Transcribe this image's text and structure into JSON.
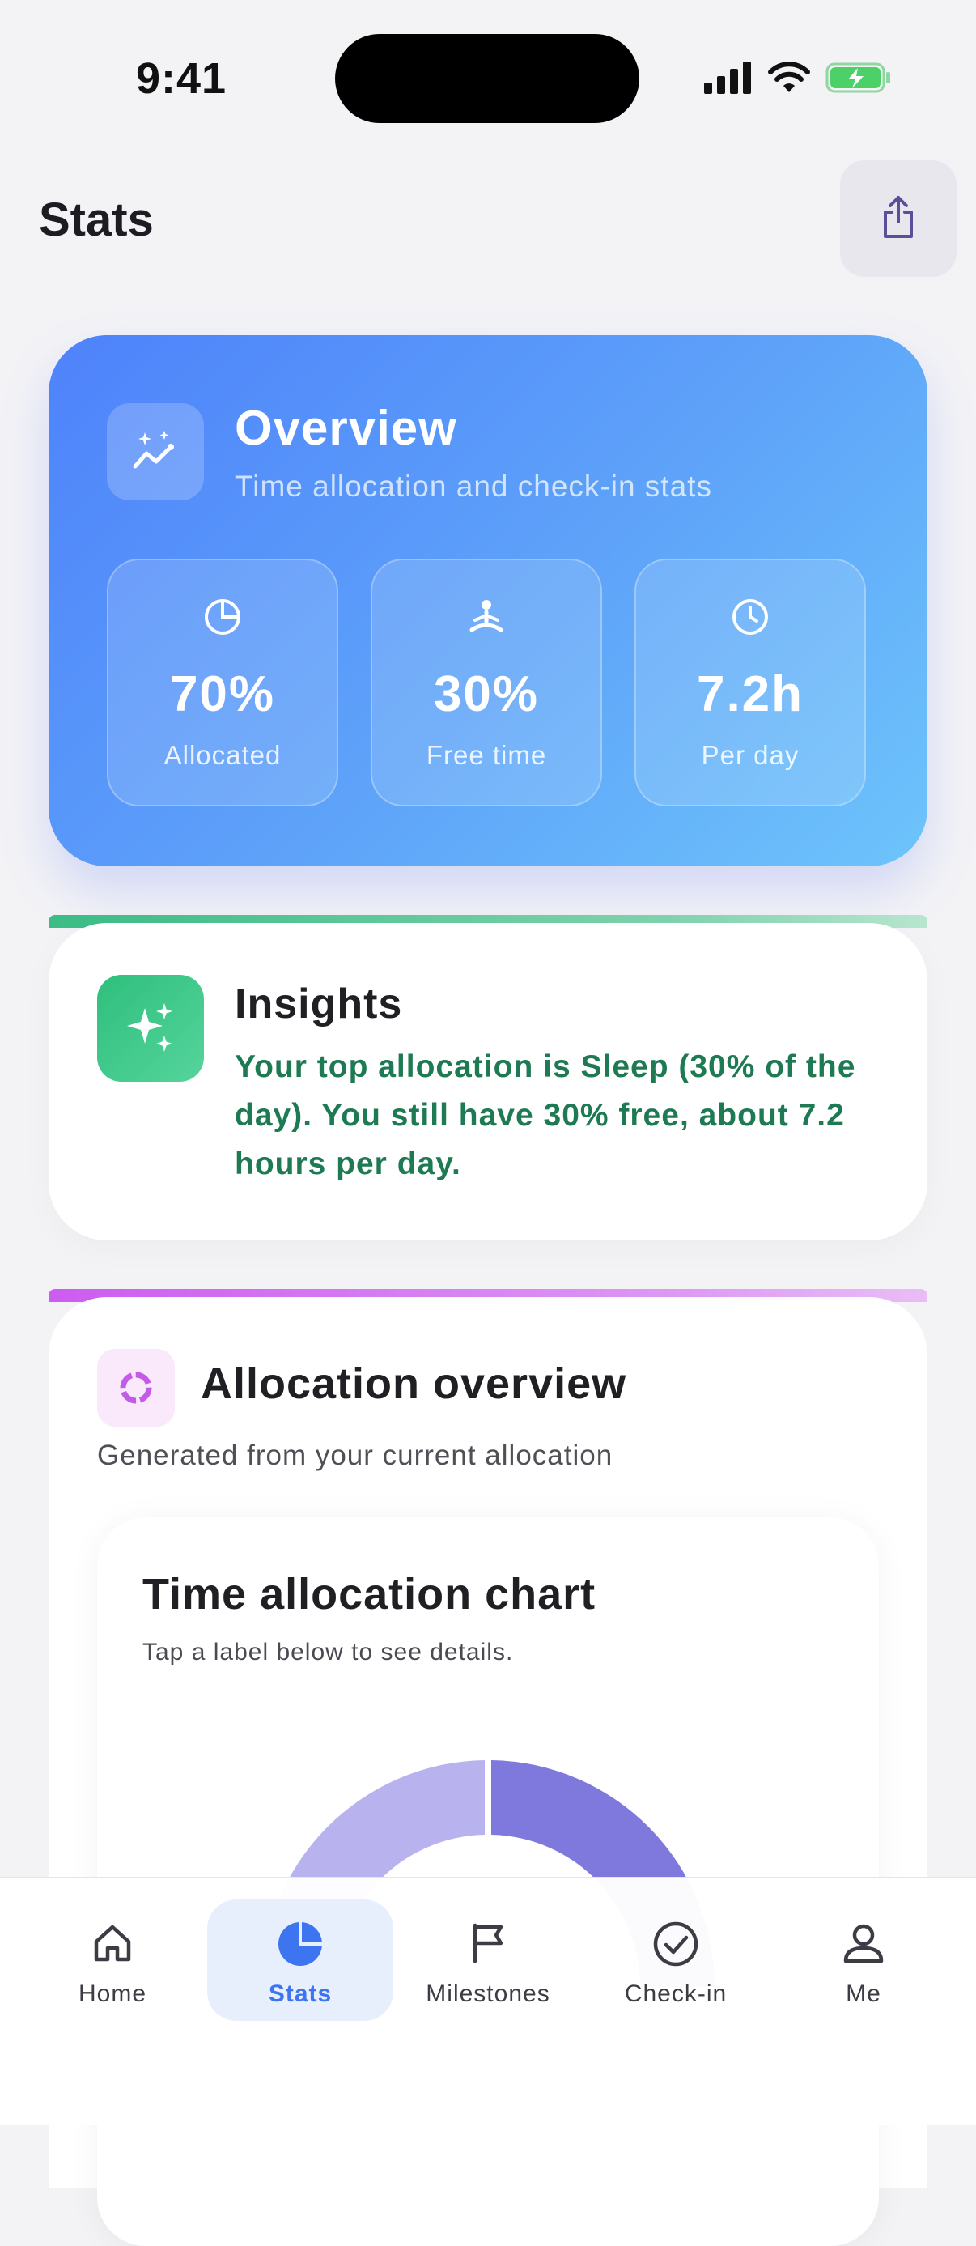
{
  "status_bar": {
    "time": "9:41",
    "icons": [
      "cellular-signal-icon",
      "wifi-icon",
      "battery-charging-icon"
    ]
  },
  "header": {
    "title": "Stats",
    "share_icon": "share-icon"
  },
  "overview": {
    "title": "Overview",
    "subtitle": "Time allocation and check-in stats",
    "icon": "trend-sparkle-icon",
    "tiles": [
      {
        "value": "70%",
        "label": "Allocated",
        "icon": "pie-chart-icon"
      },
      {
        "value": "30%",
        "label": "Free time",
        "icon": "meditation-icon"
      },
      {
        "value": "7.2h",
        "label": "Per day",
        "icon": "clock-icon"
      }
    ]
  },
  "insights": {
    "title": "Insights",
    "text": "Your top allocation is Sleep (30% of the day). You still have 30% free, about 7.2 hours per day.",
    "icon": "sparkles-icon"
  },
  "allocation": {
    "title": "Allocation overview",
    "subtitle": "Generated from your current allocation",
    "icon": "donut-icon",
    "chart_card": {
      "title": "Time allocation chart",
      "subtitle": "Tap a label below to see details."
    }
  },
  "tabbar": {
    "tabs": [
      {
        "label": "Home",
        "icon": "home-icon",
        "active": false
      },
      {
        "label": "Stats",
        "icon": "pie-chart-icon",
        "active": true
      },
      {
        "label": "Milestones",
        "icon": "flag-icon",
        "active": false
      },
      {
        "label": "Check-in",
        "icon": "check-circle-icon",
        "active": false
      },
      {
        "label": "Me",
        "icon": "person-icon",
        "active": false
      }
    ]
  },
  "colors": {
    "accent": "#3d74ef",
    "insight_text": "#1e7a53",
    "donut_dark": "#7f78dd",
    "donut_light": "#b8b3ef"
  }
}
